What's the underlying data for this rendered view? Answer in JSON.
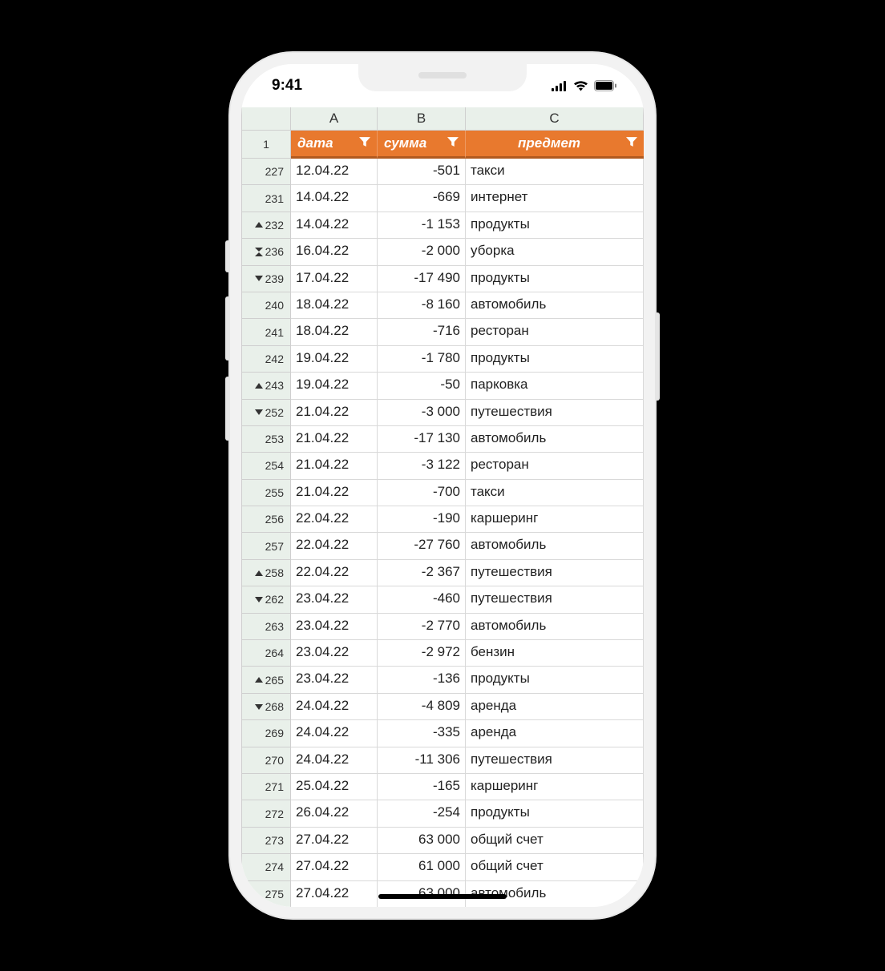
{
  "status": {
    "time": "9:41"
  },
  "columns": {
    "a": "A",
    "b": "B",
    "c": "C"
  },
  "header_rownum": "1",
  "headers": {
    "a": "дата",
    "b": "сумма",
    "c": "предмет"
  },
  "rows": [
    {
      "n": "227",
      "icon": "",
      "a": "12.04.22",
      "b": "-501",
      "c": "такси"
    },
    {
      "n": "231",
      "icon": "",
      "a": "14.04.22",
      "b": "-669",
      "c": "интернет"
    },
    {
      "n": "232",
      "icon": "up",
      "a": "14.04.22",
      "b": "-1 153",
      "c": "продукты"
    },
    {
      "n": "236",
      "icon": "collapse",
      "a": "16.04.22",
      "b": "-2 000",
      "c": "уборка"
    },
    {
      "n": "239",
      "icon": "down",
      "a": "17.04.22",
      "b": "-17 490",
      "c": "продукты"
    },
    {
      "n": "240",
      "icon": "",
      "a": "18.04.22",
      "b": "-8 160",
      "c": "автомобиль"
    },
    {
      "n": "241",
      "icon": "",
      "a": "18.04.22",
      "b": "-716",
      "c": "ресторан"
    },
    {
      "n": "242",
      "icon": "",
      "a": "19.04.22",
      "b": "-1 780",
      "c": "продукты"
    },
    {
      "n": "243",
      "icon": "up",
      "a": "19.04.22",
      "b": "-50",
      "c": "парковка"
    },
    {
      "n": "252",
      "icon": "down",
      "a": "21.04.22",
      "b": "-3 000",
      "c": "путешествия"
    },
    {
      "n": "253",
      "icon": "",
      "a": "21.04.22",
      "b": "-17 130",
      "c": "автомобиль"
    },
    {
      "n": "254",
      "icon": "",
      "a": "21.04.22",
      "b": "-3 122",
      "c": "ресторан"
    },
    {
      "n": "255",
      "icon": "",
      "a": "21.04.22",
      "b": "-700",
      "c": "такси"
    },
    {
      "n": "256",
      "icon": "",
      "a": "22.04.22",
      "b": "-190",
      "c": "каршеринг"
    },
    {
      "n": "257",
      "icon": "",
      "a": "22.04.22",
      "b": "-27 760",
      "c": "автомобиль"
    },
    {
      "n": "258",
      "icon": "up",
      "a": "22.04.22",
      "b": "-2 367",
      "c": "путешествия"
    },
    {
      "n": "262",
      "icon": "down",
      "a": "23.04.22",
      "b": "-460",
      "c": "путешествия"
    },
    {
      "n": "263",
      "icon": "",
      "a": "23.04.22",
      "b": "-2 770",
      "c": "автомобиль"
    },
    {
      "n": "264",
      "icon": "",
      "a": "23.04.22",
      "b": "-2 972",
      "c": "бензин"
    },
    {
      "n": "265",
      "icon": "up",
      "a": "23.04.22",
      "b": "-136",
      "c": "продукты"
    },
    {
      "n": "268",
      "icon": "down",
      "a": "24.04.22",
      "b": "-4 809",
      "c": "аренда"
    },
    {
      "n": "269",
      "icon": "",
      "a": "24.04.22",
      "b": "-335",
      "c": "аренда"
    },
    {
      "n": "270",
      "icon": "",
      "a": "24.04.22",
      "b": "-11 306",
      "c": "путешествия"
    },
    {
      "n": "271",
      "icon": "",
      "a": "25.04.22",
      "b": "-165",
      "c": "каршеринг"
    },
    {
      "n": "272",
      "icon": "",
      "a": "26.04.22",
      "b": "-254",
      "c": "продукты"
    },
    {
      "n": "273",
      "icon": "",
      "a": "27.04.22",
      "b": "63 000",
      "c": "общий счет"
    },
    {
      "n": "274",
      "icon": "",
      "a": "27.04.22",
      "b": "61 000",
      "c": "общий счет"
    },
    {
      "n": "275",
      "icon": "",
      "a": "27.04.22",
      "b": "63 000",
      "c": "автомобиль"
    }
  ]
}
